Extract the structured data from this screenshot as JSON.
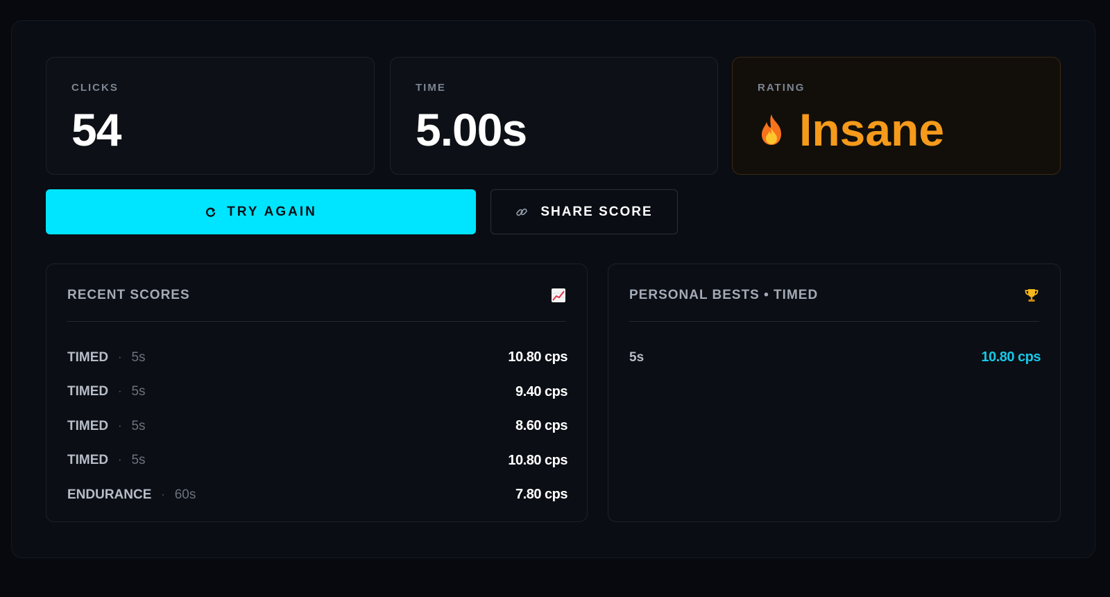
{
  "stats": {
    "clicks": {
      "label": "CLICKS",
      "value": "54"
    },
    "time": {
      "label": "TIME",
      "value": "5.00s"
    },
    "rating": {
      "label": "RATING",
      "value": "Insane",
      "icon": "fire-icon"
    }
  },
  "actions": {
    "try_again": {
      "label": "TRY AGAIN",
      "icon": "restart-icon"
    },
    "share": {
      "label": "SHARE SCORE",
      "icon": "link-icon"
    }
  },
  "recent": {
    "title": "RECENT SCORES",
    "icon": "chart-icon",
    "rows": [
      {
        "mode": "TIMED",
        "duration": "5s",
        "score": "10.80 cps"
      },
      {
        "mode": "TIMED",
        "duration": "5s",
        "score": "9.40 cps"
      },
      {
        "mode": "TIMED",
        "duration": "5s",
        "score": "8.60 cps"
      },
      {
        "mode": "TIMED",
        "duration": "5s",
        "score": "10.80 cps"
      },
      {
        "mode": "ENDURANCE",
        "duration": "60s",
        "score": "7.80 cps"
      }
    ]
  },
  "bests": {
    "title": "PERSONAL BESTS • TIMED",
    "icon": "trophy-icon",
    "rows": [
      {
        "duration": "5s",
        "score": "10.80 cps"
      }
    ]
  },
  "colors": {
    "accent": "#00e5ff",
    "rating": "#f59a1b",
    "best_score": "#18c8e8",
    "background": "#07090e"
  }
}
